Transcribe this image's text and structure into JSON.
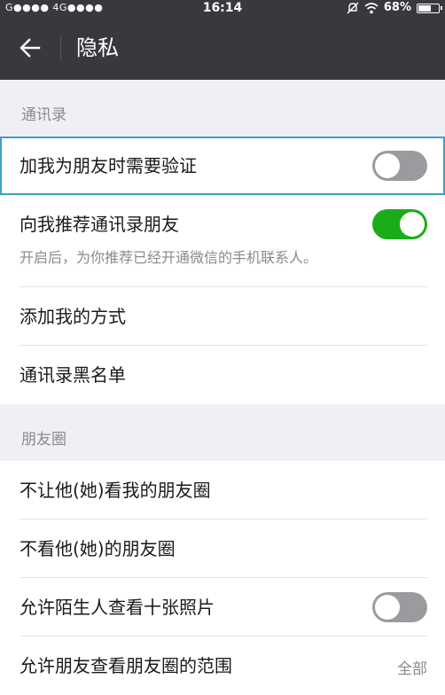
{
  "status_bar": {
    "carrier_text": "G●●●● 4G●●●●",
    "time": "16:14",
    "battery_percent": "68%",
    "battery_level": 0.68,
    "icons": [
      "mute-icon",
      "wifi-icon",
      "battery-icon"
    ]
  },
  "header": {
    "title": "隐私",
    "back_icon": "arrow-left-icon"
  },
  "sections": [
    {
      "label": "通讯录",
      "items": [
        {
          "label": "加我为朋友时需要验证",
          "toggle": "off",
          "focused": true
        },
        {
          "label": "向我推荐通讯录朋友",
          "toggle": "on",
          "description": "开启后，为你推荐已经开通微信的手机联系人。"
        },
        {
          "label": "添加我的方式"
        },
        {
          "label": "通讯录黑名单"
        }
      ]
    },
    {
      "label": "朋友圈",
      "items": [
        {
          "label": "不让他(她)看我的朋友圈"
        },
        {
          "label": "不看他(她)的朋友圈"
        },
        {
          "label": "允许陌生人查看十张照片",
          "toggle": "off"
        },
        {
          "label": "允许朋友查看朋友圈的范围",
          "value": "全部"
        }
      ]
    }
  ],
  "colors": {
    "header_bg": "#38393d",
    "page_bg": "#efeff4",
    "toggle_on": "#1aad19",
    "toggle_off": "#9b9b9f",
    "focus_outline": "#3aa0c4"
  }
}
